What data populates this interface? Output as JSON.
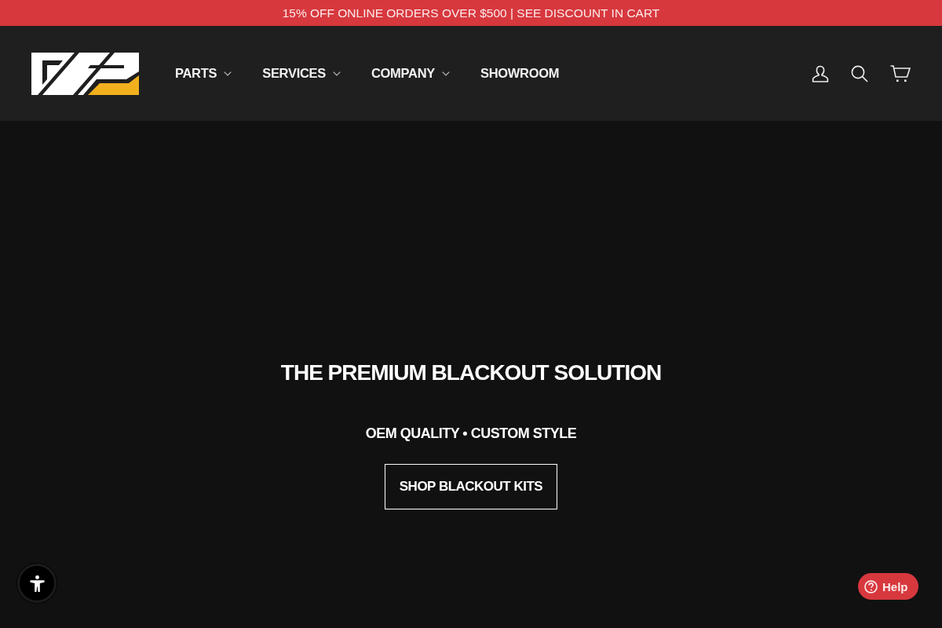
{
  "announcement": "15% OFF ONLINE ORDERS OVER $500 | SEE DISCOUNT IN CART",
  "nav": [
    {
      "label": "PARTS",
      "has_dropdown": true
    },
    {
      "label": "SERVICES",
      "has_dropdown": true
    },
    {
      "label": "COMPANY",
      "has_dropdown": true
    },
    {
      "label": "SHOWROOM",
      "has_dropdown": false
    }
  ],
  "hero": {
    "title": "THE PREMIUM BLACKOUT SOLUTION",
    "subtitle": "OEM QUALITY • CUSTOM STYLE",
    "button": "SHOP BLACKOUT KITS"
  },
  "help_button": "Help"
}
